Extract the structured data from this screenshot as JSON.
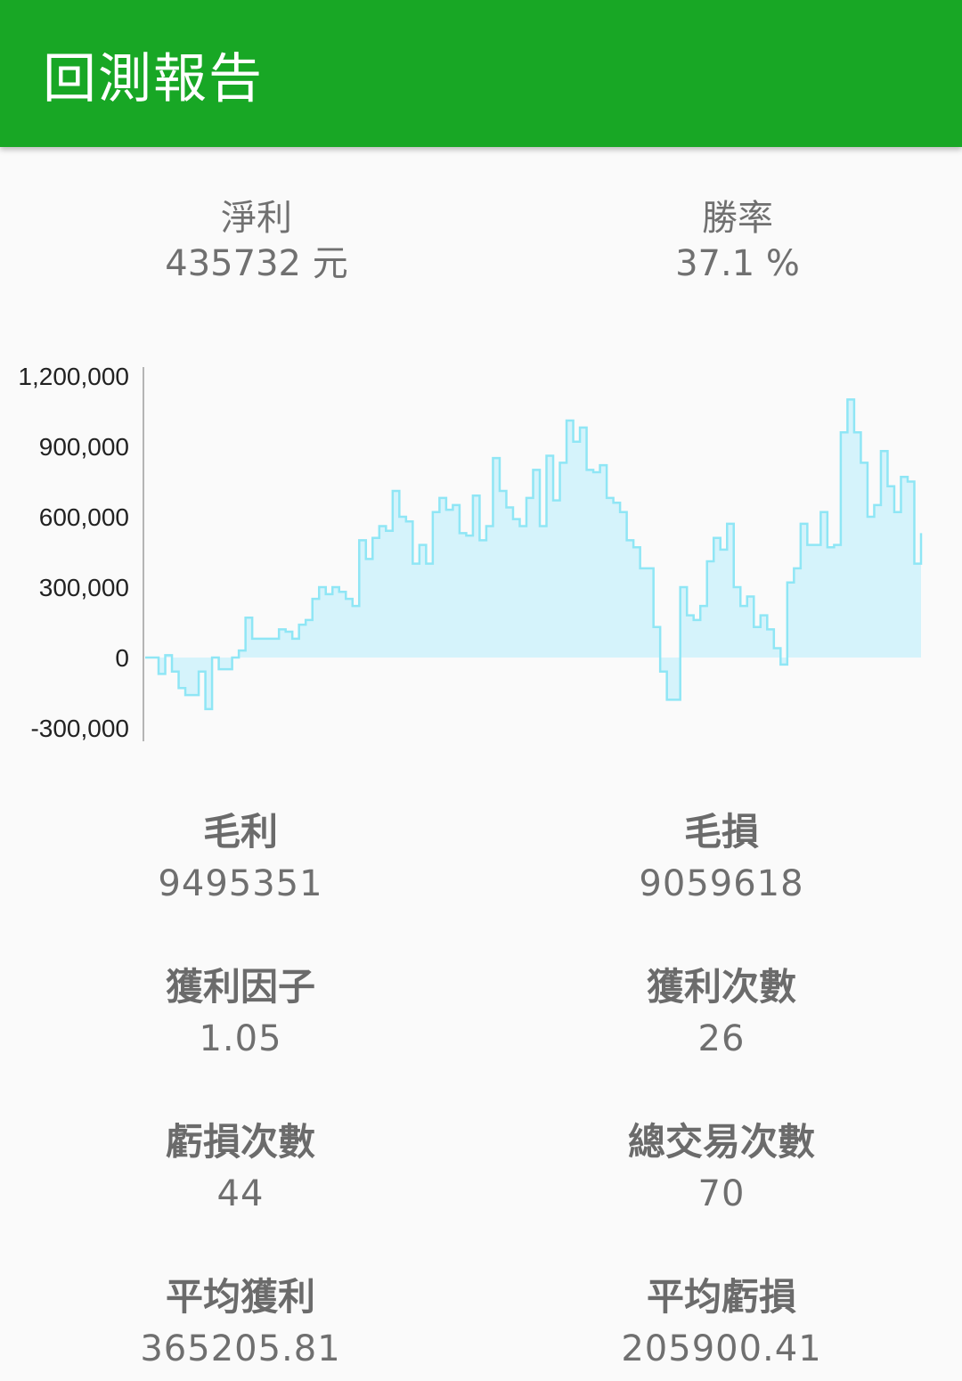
{
  "appbar": {
    "title": "回測報告"
  },
  "summary": [
    {
      "label": "淨利",
      "value": "435732 元"
    },
    {
      "label": "勝率",
      "value": "37.1 %"
    }
  ],
  "stats": [
    {
      "label": "毛利",
      "value": "9495351"
    },
    {
      "label": "毛損",
      "value": "9059618"
    },
    {
      "label": "獲利因子",
      "value": "1.05"
    },
    {
      "label": "獲利次數",
      "value": "26"
    },
    {
      "label": "虧損次數",
      "value": "44"
    },
    {
      "label": "總交易次數",
      "value": "70"
    },
    {
      "label": "平均獲利",
      "value": "365205.81"
    },
    {
      "label": "平均虧損",
      "value": "205900.41"
    }
  ],
  "colors": {
    "appbar": "#18a725",
    "line": "#8fe6f5",
    "fill": "#d5f3fb"
  },
  "chart_data": {
    "type": "area",
    "ylim": [
      -300000,
      1200000
    ],
    "y_ticks": [
      "1,200,000",
      "900,000",
      "600,000",
      "300,000",
      "0",
      "-300,000"
    ],
    "y_tick_values": [
      1200000,
      900000,
      600000,
      300000,
      0,
      -300000
    ],
    "values": [
      0,
      0,
      -70000,
      10000,
      -60000,
      -130000,
      -160000,
      -160000,
      -60000,
      -220000,
      0,
      -50000,
      -50000,
      0,
      30000,
      170000,
      80000,
      80000,
      80000,
      80000,
      120000,
      110000,
      80000,
      140000,
      160000,
      250000,
      300000,
      270000,
      300000,
      280000,
      250000,
      220000,
      500000,
      420000,
      510000,
      560000,
      540000,
      710000,
      600000,
      580000,
      400000,
      480000,
      400000,
      620000,
      680000,
      630000,
      650000,
      530000,
      520000,
      690000,
      500000,
      560000,
      850000,
      710000,
      640000,
      590000,
      560000,
      680000,
      800000,
      560000,
      860000,
      670000,
      830000,
      1010000,
      920000,
      980000,
      800000,
      790000,
      820000,
      680000,
      660000,
      620000,
      500000,
      470000,
      380000,
      380000,
      130000,
      -60000,
      -180000,
      -180000,
      300000,
      180000,
      160000,
      220000,
      410000,
      510000,
      460000,
      570000,
      300000,
      220000,
      260000,
      130000,
      180000,
      120000,
      40000,
      -30000,
      320000,
      380000,
      570000,
      480000,
      480000,
      620000,
      470000,
      480000,
      960000,
      1100000,
      960000,
      830000,
      600000,
      650000,
      880000,
      730000,
      620000,
      770000,
      750000,
      400000,
      530000
    ]
  }
}
